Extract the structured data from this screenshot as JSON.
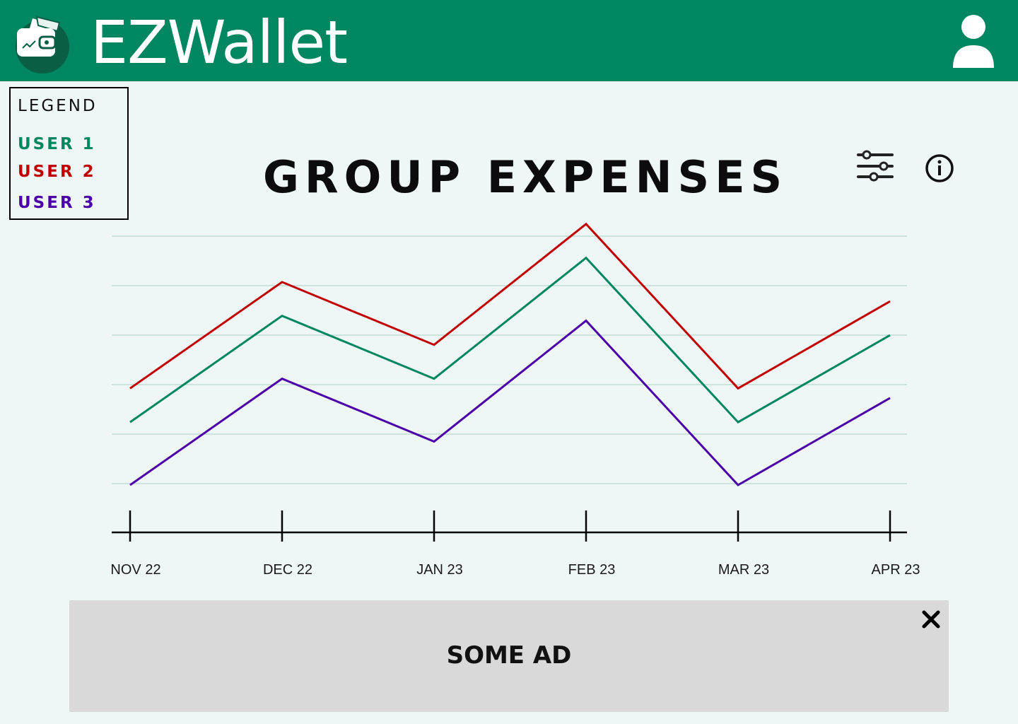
{
  "app": {
    "title": "EZWallet"
  },
  "header": {
    "logo_icon": "wallet-icon",
    "profile_icon": "user-avatar-icon",
    "bar_color": "#008660"
  },
  "legend": {
    "title": "LEGEND",
    "items": [
      {
        "label": "USER 1",
        "color": "#008660"
      },
      {
        "label": "USER 2",
        "color": "#c00000"
      },
      {
        "label": "USER 3",
        "color": "#4b00a8"
      }
    ]
  },
  "toolbar": {
    "filter_icon": "sliders-icon",
    "info_icon": "info-icon"
  },
  "chart_data": {
    "type": "line",
    "title": "GROUP EXPENSES",
    "xlabel": "",
    "ylabel": "",
    "grid": true,
    "categories": [
      "NOV 22",
      "DEC 22",
      "JAN 23",
      "FEB 23",
      "MAR 23",
      "APR 23"
    ],
    "series": [
      {
        "name": "USER 1",
        "color": "#008660",
        "values": [
          1.3,
          3.5,
          2.2,
          4.7,
          1.3,
          3.1
        ]
      },
      {
        "name": "USER 2",
        "color": "#c00000",
        "values": [
          2.0,
          4.2,
          2.9,
          5.4,
          2.0,
          3.8
        ]
      },
      {
        "name": "USER 3",
        "color": "#4b00a8",
        "values": [
          0.0,
          2.2,
          0.9,
          3.4,
          0.0,
          1.8
        ]
      }
    ],
    "ylim": [
      0,
      5.5
    ]
  },
  "ad": {
    "label": "SOME AD",
    "close_icon": "close-icon"
  }
}
